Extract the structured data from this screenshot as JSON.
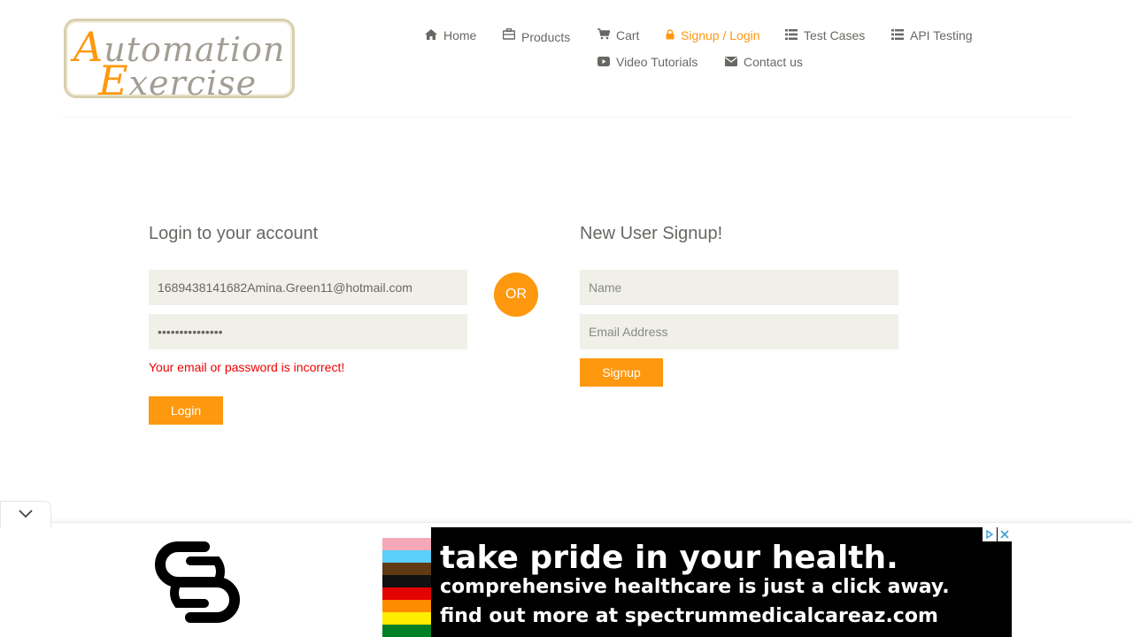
{
  "logo": {
    "line1_cap": "A",
    "line1_rest": "utomation",
    "line2_cap": "E",
    "line2_rest": "xercise"
  },
  "nav": {
    "items": [
      {
        "label": "Home",
        "icon": "home-icon"
      },
      {
        "label": "Products",
        "icon": "briefcase-icon"
      },
      {
        "label": "Cart",
        "icon": "cart-icon"
      },
      {
        "label": "Signup / Login",
        "icon": "lock-icon",
        "active": true
      },
      {
        "label": "Test Cases",
        "icon": "list-icon"
      },
      {
        "label": "API Testing",
        "icon": "list-icon"
      },
      {
        "label": "Video Tutorials",
        "icon": "youtube-play-icon"
      },
      {
        "label": "Contact us",
        "icon": "envelope-icon"
      }
    ]
  },
  "login": {
    "title": "Login to your account",
    "email_value": "1689438141682Amina.Green11@hotmail.com",
    "password_value": "•••••••••••••••",
    "error": "Your email or password is incorrect!",
    "button": "Login"
  },
  "or_label": "OR",
  "signup": {
    "title": "New User Signup!",
    "name_placeholder": "Name",
    "email_placeholder": "Email Address",
    "button": "Signup"
  },
  "ad": {
    "line1": "take pride in your health.",
    "line2": "comprehensive healthcare is just a click away.",
    "line3": "find out more at spectrummedicalcareaz.com",
    "adchoices_icon": "adchoices-icon",
    "close_icon": "close-icon"
  },
  "colors": {
    "accent": "#fe980f",
    "text": "#696763",
    "input_bg": "#f0f0e9",
    "error": "#ee0000"
  }
}
